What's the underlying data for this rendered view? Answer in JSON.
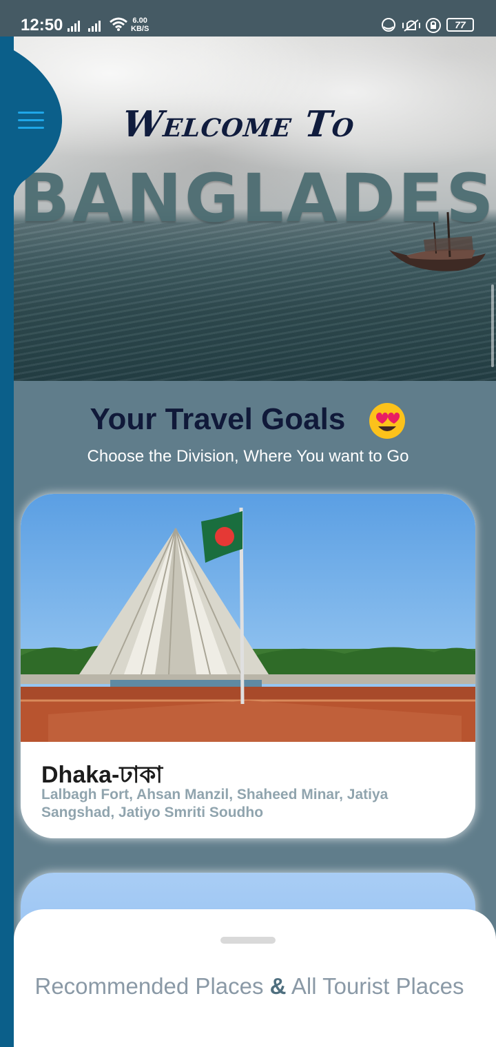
{
  "status_bar": {
    "time": "12:50",
    "speed_value": "6.00",
    "speed_unit": "KB/S",
    "battery": "77",
    "icons": [
      "signal-icon",
      "signal-icon",
      "wifi-icon",
      "data-saver-icon",
      "vibrate-icon",
      "rotation-lock-icon",
      "battery-icon"
    ]
  },
  "hero": {
    "title": "Welcome To",
    "word": "BANGLADESH"
  },
  "menu": {
    "icon": "hamburger-menu-icon"
  },
  "header": {
    "title": "Your Travel Goals",
    "emoji": "heart-eyes-emoji",
    "subtitle": "Choose the Division, Where You want to Go"
  },
  "cards": [
    {
      "title": "Dhaka-ঢাকা",
      "description": "Lalbagh Fort, Ahsan Manzil, Shaheed Minar, Jatiya Sangshad, Jatiyo Smriti Soudho"
    }
  ],
  "bottom_sheet": {
    "title_part1": "Recommended Places ",
    "title_amp": "&",
    "title_part2": " All Tourist Places"
  },
  "colors": {
    "background": "#607d8b",
    "status_bar": "#455a64",
    "rail": "#0b5f8a",
    "menu_icon": "#1fa7e8",
    "title": "#101939",
    "card_desc": "#90a4ae",
    "sheet_text": "#8a99a6"
  }
}
